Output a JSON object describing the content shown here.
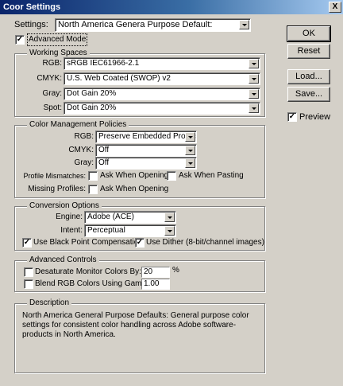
{
  "window": {
    "title": "Coor Settings",
    "close_glyph": "X"
  },
  "settings": {
    "label": "Settings:",
    "value": "North America Genera Purpose Default:"
  },
  "advanced_mode": {
    "label": "Advanced Mode",
    "checked": true
  },
  "working_spaces": {
    "legend": "Working Spaces",
    "rows": [
      {
        "label": "RGB:",
        "value": "sRGB IEC61966-2.1"
      },
      {
        "label": "CMYK:",
        "value": "U.S. Web Coated (SWOP) v2"
      },
      {
        "label": "Gray:",
        "value": "Dot Gain 20%"
      },
      {
        "label": "Spot:",
        "value": "Dot Gain 20%"
      }
    ]
  },
  "color_management": {
    "legend": "Color Management Policies",
    "rows": [
      {
        "label": "RGB:",
        "value": "Preserve Embedded Profiles"
      },
      {
        "label": "CMYK:",
        "value": "Off"
      },
      {
        "label": "Gray:",
        "value": "Off"
      }
    ],
    "mismatches_label": "Profile Mismatches:",
    "ask_opening": "Ask When Opening",
    "ask_pasting": "Ask When Pasting",
    "missing_label": "Missing Profiles:",
    "missing_ask_opening": "Ask When Opening"
  },
  "conversion": {
    "legend": "Conversion Options",
    "engine_label": "Engine:",
    "engine_value": "Adobe (ACE)",
    "intent_label": "Intent:",
    "intent_value": "Perceptual",
    "black_point": "Use Black Point Compensation",
    "dither": "Use Dither (8-bit/channel images)"
  },
  "advanced_controls": {
    "legend": "Advanced Controls",
    "desaturate": "Desaturate Monitor Colors By:",
    "desaturate_value": "20",
    "desaturate_unit": "%",
    "blend": "Blend RGB Colors Using Gamma:",
    "blend_value": "1.00"
  },
  "description": {
    "legend": "Description",
    "text": "North America General Purpose Defaults:  General purpose color settings for consistent color handling across Adobe software-products in North America."
  },
  "buttons": {
    "ok": "OK",
    "reset": "Reset",
    "load": "Load...",
    "save": "Save...",
    "preview": "Preview"
  }
}
